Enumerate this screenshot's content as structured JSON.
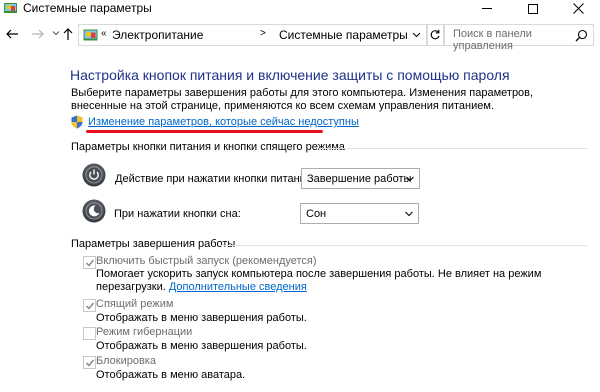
{
  "window": {
    "title": "Системные параметры"
  },
  "nav": {
    "breadcrumb_prefix": "«",
    "breadcrumb": [
      "Электропитание",
      "Системные параметры"
    ],
    "separator": ">",
    "search_placeholder": "Поиск в панели управления"
  },
  "main": {
    "title": "Настройка кнопок питания и включение защиты с помощью пароля",
    "intro": "Выберите параметры завершения работы для этого компьютера. Изменения параметров, внесенные на этой странице, применяются ко всем схемам управления питанием.",
    "change_link": "Изменение параметров, которые сейчас недоступны",
    "power_section": {
      "title": "Параметры кнопки питания и кнопки спящего режима",
      "power_label": "Действие при нажатии кнопки питания:",
      "power_value": "Завершение работы",
      "sleep_label": "При нажатии кнопки сна:",
      "sleep_value": "Сон"
    },
    "shutdown_section": {
      "title": "Параметры завершения работы",
      "options": [
        {
          "label": "Включить быстрый запуск (рекомендуется)",
          "checked": true,
          "description": "Помогает ускорить запуск компьютера после завершения работы. Не влияет на режим перезагрузки.",
          "link": "Дополнительные сведения"
        },
        {
          "label": "Спящий режим",
          "checked": true,
          "description": "Отображать в меню завершения работы."
        },
        {
          "label": "Режим гибернации",
          "checked": false,
          "description": "Отображать в меню завершения работы."
        },
        {
          "label": "Блокировка",
          "checked": true,
          "description": "Отображать в меню аватара."
        }
      ]
    }
  },
  "colors": {
    "title_blue": "#1e3287",
    "link_blue": "#0066cc",
    "highlight_red": "#e8101c",
    "disabled_gray": "#6d6d6d"
  },
  "icons": [
    "control-panel-icon",
    "back-arrow-icon",
    "forward-arrow-icon",
    "up-arrow-icon",
    "refresh-icon",
    "search-icon",
    "shield-icon",
    "power-icon",
    "sleep-icon",
    "chevron-down-icon",
    "checkmark-icon"
  ]
}
